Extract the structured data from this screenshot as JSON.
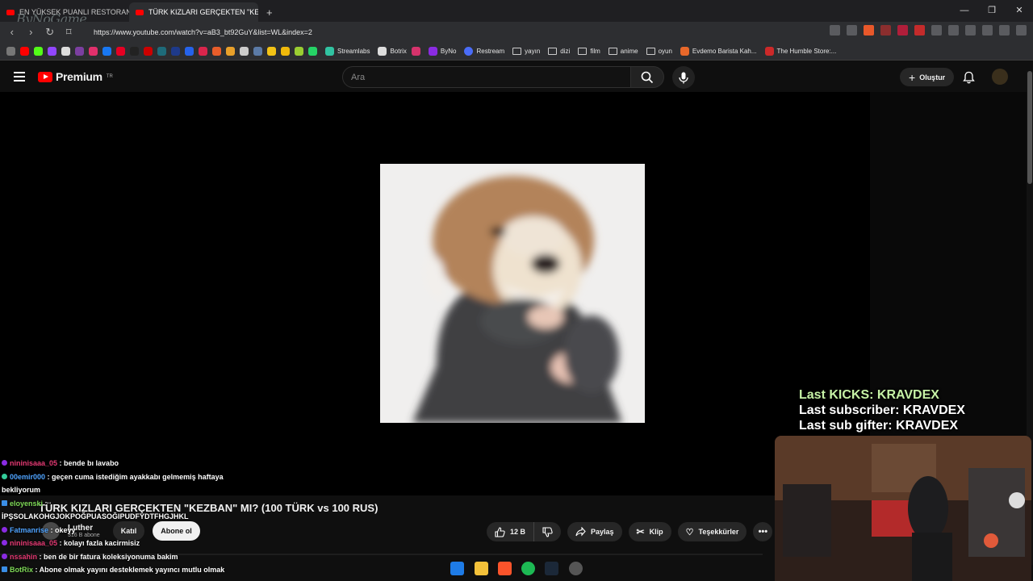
{
  "browser": {
    "tabs": [
      {
        "label": "EN YÜKSEK PUANLI RESTORANLAR",
        "active": false
      },
      {
        "label": "TÜRK KIZLARI GERÇEKTEN \"KEZBAN\"",
        "active": true
      }
    ],
    "url": "https://www.youtube.com/watch?v=aB3_bt92GuY&list=WL&index=2",
    "watermark": "ByNoGame",
    "bookmarks": [
      "Streamlabs",
      "Botrix",
      "ByNo",
      "Restream",
      "yayın",
      "dizi",
      "film",
      "anime",
      "oyun",
      "Evdemo Barista Kah...",
      "The Humble Store:..."
    ]
  },
  "youtube": {
    "logo": "Premium",
    "logo_sup": "TR",
    "search_placeholder": "Ara",
    "create_label": "Oluştur",
    "video_title": "TÜRK KIZLARI GERÇEKTEN \"KEZBAN\" MI? (100 TÜRK vs 100 RUS)",
    "channel_name": "Luther",
    "subscribers": "316 B abone",
    "join_label": "Katıl",
    "subscribe_label": "Abone ol",
    "like_count": "12 B",
    "share_label": "Paylaş",
    "clip_label": "Klip",
    "thanks_label": "Teşekkürler",
    "more_label": "•••"
  },
  "chat": [
    {
      "user": "nininisaaa_05",
      "text": " : bende bı lavabo"
    },
    {
      "user": "00emir000",
      "text": " : geçen cuma istediğim ayakkabı gelmemiş haftaya"
    },
    {
      "user": "",
      "text": "bekliyorum"
    },
    {
      "user": "eloyenski",
      "text": " :"
    },
    {
      "user": "",
      "text": "İPŞSOLAKOHGJOKPOĞPUASOĞIPUDFYDTFHGJHKL"
    },
    {
      "user": "Fatmanrise",
      "text": " : okeyy"
    },
    {
      "user": "nininisaaa_05",
      "text": " : kolayı fazla kacirmisiz"
    },
    {
      "user": "nssahin",
      "text": " : ben de bir fatura koleksiyonuma bakim"
    },
    {
      "user": "BotRix",
      "text": " : Abone olmak yayını desteklemek yayıncı mutlu olmak"
    }
  ],
  "stream_overlay": {
    "last_kicks": "Last KICKS: KRAVDEX",
    "last_subscriber": "Last subscriber: KRAVDEX",
    "last_sub_gifter": "Last sub gifter: KRAVDEX"
  },
  "colors": {
    "brand_red": "#ff0000",
    "background": "#0f0f0f",
    "chat_user_pink": "#e63a74",
    "chat_user_blue": "#4fa3ff",
    "chat_user_green": "#7ed957"
  }
}
